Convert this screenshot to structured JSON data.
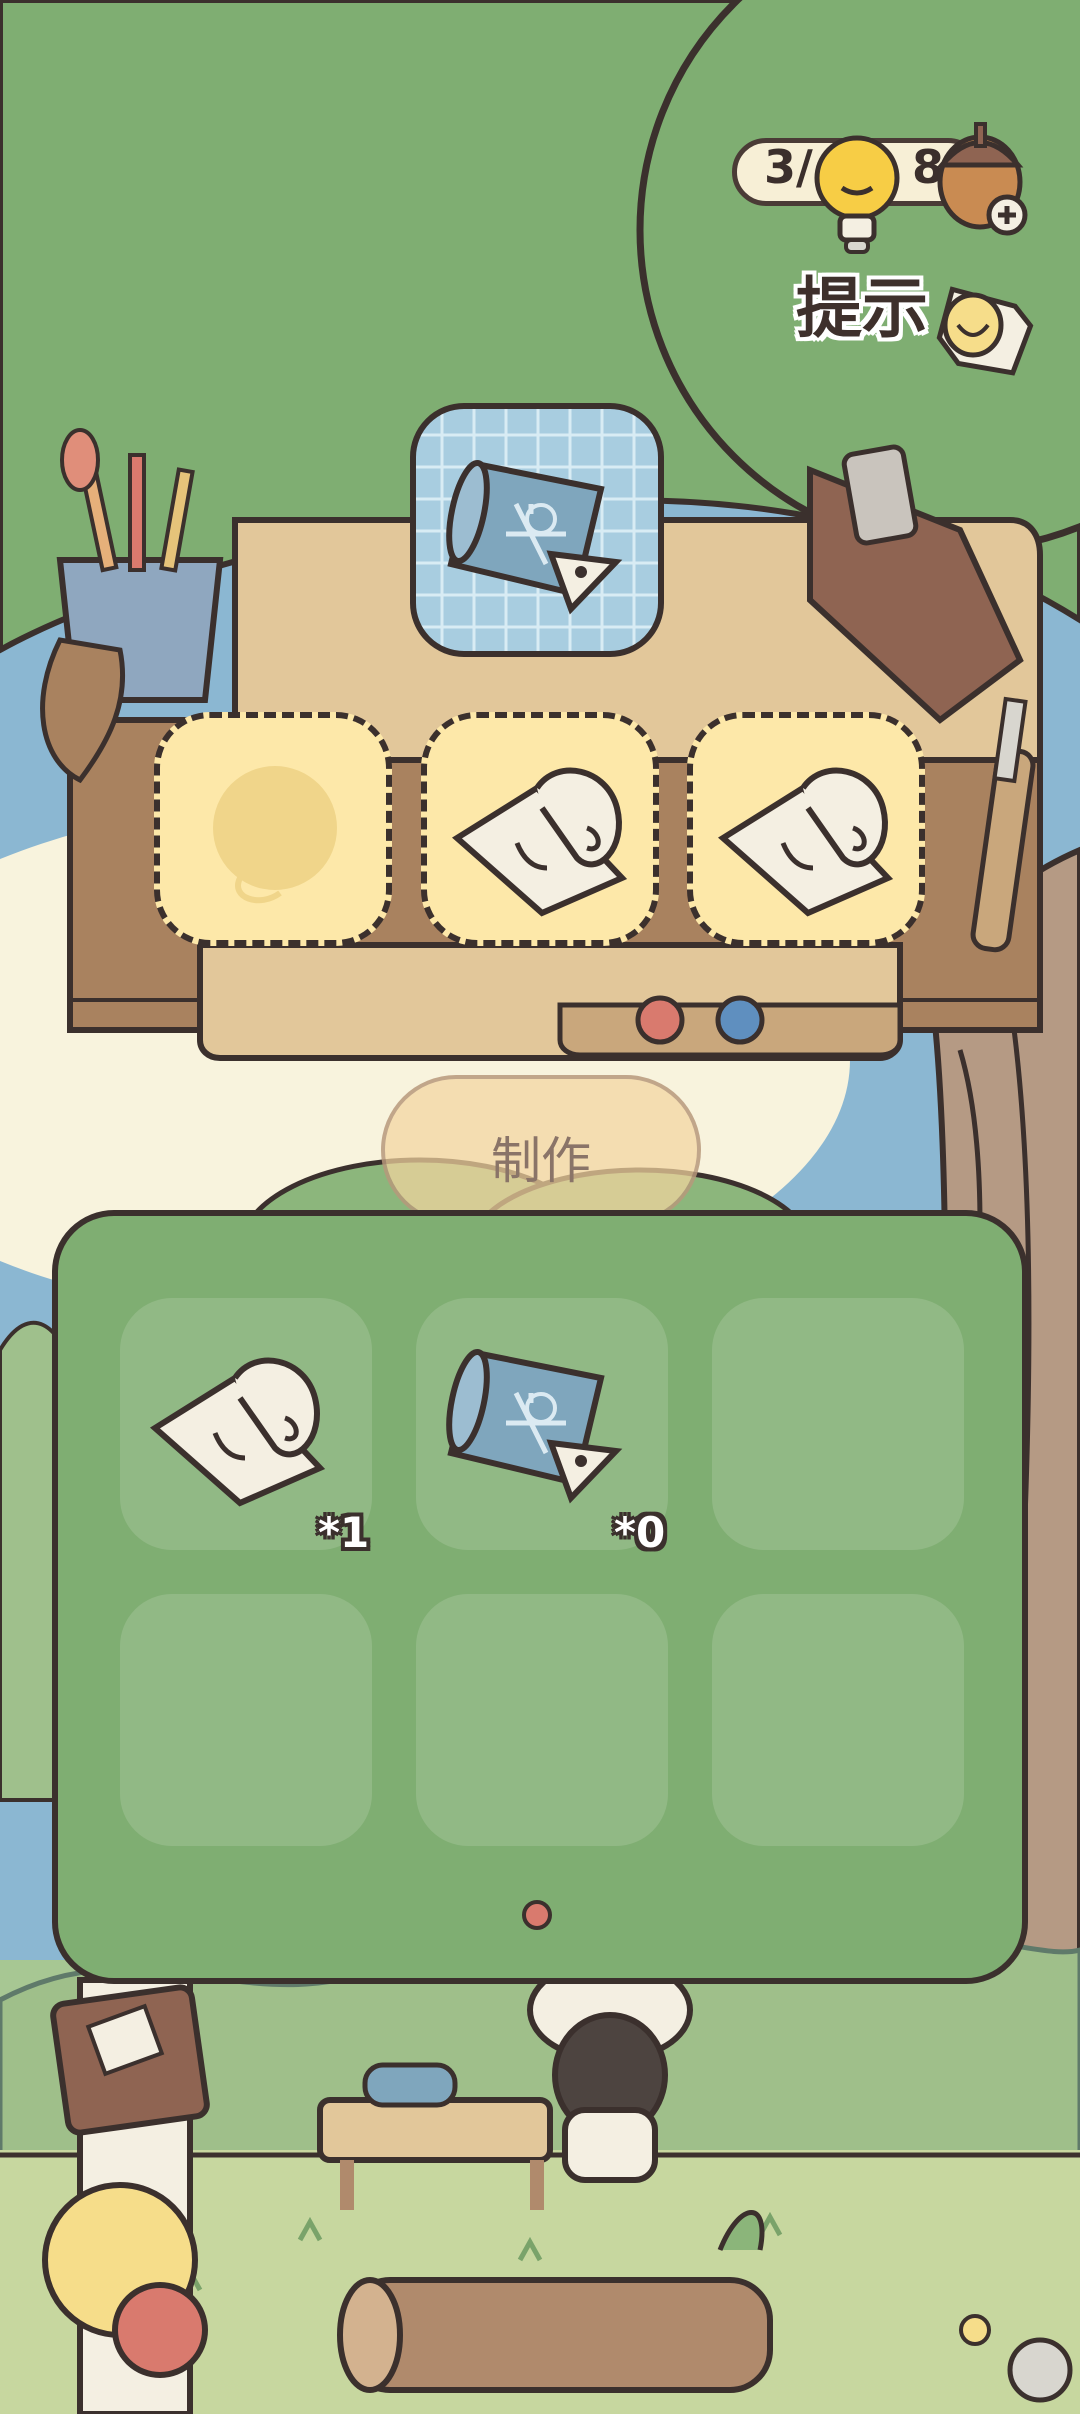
{
  "hint": {
    "counter_left": "3/",
    "counter_right": "8",
    "label": "提示"
  },
  "recipe": {
    "target_item": "blueprint-scroll-icon",
    "slots": [
      {
        "state": "empty",
        "ghost_item": "yarn-ball-icon"
      },
      {
        "state": "filled",
        "item": "paper-scroll-icon"
      },
      {
        "state": "filled",
        "item": "paper-scroll-icon"
      }
    ]
  },
  "make_button": {
    "label": "制作",
    "enabled": false
  },
  "inventory": {
    "items": [
      {
        "item": "paper-scroll-icon",
        "quantity": "*1"
      },
      {
        "item": "blueprint-scroll-icon",
        "quantity": "*0"
      },
      {
        "item": null,
        "quantity": null
      },
      {
        "item": null,
        "quantity": null
      },
      {
        "item": null,
        "quantity": null
      },
      {
        "item": null,
        "quantity": null
      }
    ],
    "page_count": 1,
    "current_page": 1
  },
  "colors": {
    "tree_green": "#7fae72",
    "panel_green": "#7fae72",
    "sky_blue": "#8bb7d2",
    "slot_yellow": "#fde8a9",
    "outline": "#3b302d",
    "table_wood": "#e2c79a"
  }
}
